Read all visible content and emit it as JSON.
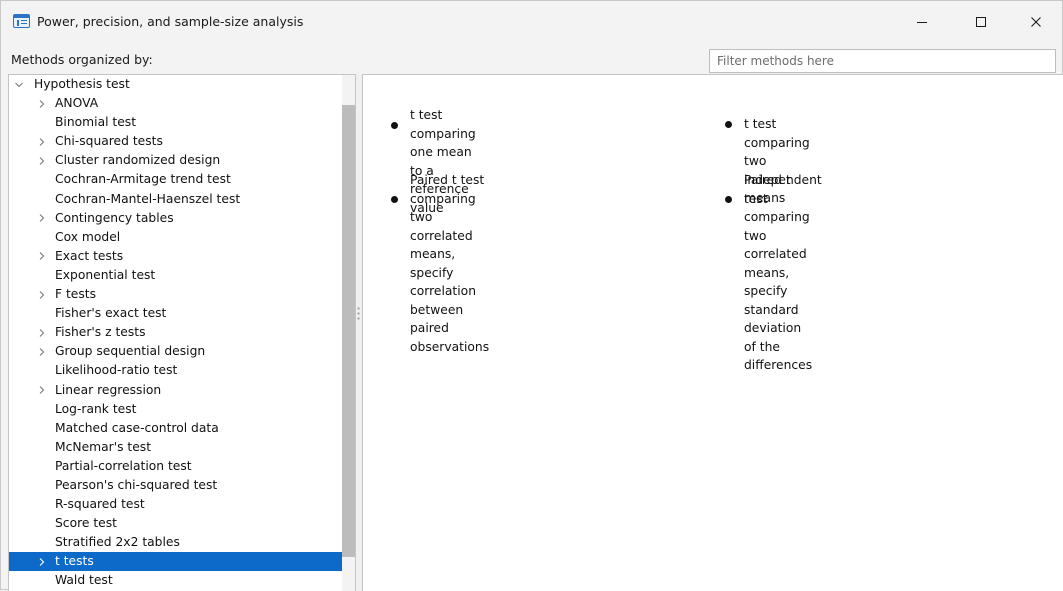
{
  "window": {
    "title": "Power, precision, and sample-size analysis",
    "minimize_icon": "minimize-icon",
    "maximize_icon": "maximize-icon",
    "close_icon": "close-icon"
  },
  "header": {
    "methods_label": "Methods organized by:",
    "filter_placeholder": "Filter methods here",
    "filter_value": ""
  },
  "tree": {
    "root": {
      "label": "Hypothesis test",
      "expanded": true
    },
    "items": [
      {
        "label": "ANOVA",
        "expandable": true,
        "selected": false
      },
      {
        "label": "Binomial test",
        "expandable": false,
        "selected": false
      },
      {
        "label": "Chi-squared tests",
        "expandable": true,
        "selected": false
      },
      {
        "label": "Cluster randomized design",
        "expandable": true,
        "selected": false
      },
      {
        "label": "Cochran-Armitage trend test",
        "expandable": false,
        "selected": false
      },
      {
        "label": "Cochran-Mantel-Haenszel test",
        "expandable": false,
        "selected": false
      },
      {
        "label": "Contingency tables",
        "expandable": true,
        "selected": false
      },
      {
        "label": "Cox model",
        "expandable": false,
        "selected": false
      },
      {
        "label": "Exact tests",
        "expandable": true,
        "selected": false
      },
      {
        "label": "Exponential test",
        "expandable": false,
        "selected": false
      },
      {
        "label": "F tests",
        "expandable": true,
        "selected": false
      },
      {
        "label": "Fisher's exact test",
        "expandable": false,
        "selected": false
      },
      {
        "label": "Fisher's z tests",
        "expandable": true,
        "selected": false
      },
      {
        "label": "Group sequential design",
        "expandable": true,
        "selected": false
      },
      {
        "label": "Likelihood-ratio test",
        "expandable": false,
        "selected": false
      },
      {
        "label": "Linear regression",
        "expandable": true,
        "selected": false
      },
      {
        "label": "Log-rank test",
        "expandable": false,
        "selected": false
      },
      {
        "label": "Matched case-control data",
        "expandable": false,
        "selected": false
      },
      {
        "label": "McNemar's test",
        "expandable": false,
        "selected": false
      },
      {
        "label": "Partial-correlation test",
        "expandable": false,
        "selected": false
      },
      {
        "label": "Pearson's chi-squared test",
        "expandable": false,
        "selected": false
      },
      {
        "label": "R-squared test",
        "expandable": false,
        "selected": false
      },
      {
        "label": "Score test",
        "expandable": false,
        "selected": false
      },
      {
        "label": "Stratified 2x2 tables",
        "expandable": false,
        "selected": false
      },
      {
        "label": "t tests",
        "expandable": true,
        "selected": true
      },
      {
        "label": "Wald test",
        "expandable": false,
        "selected": false
      }
    ]
  },
  "methods": [
    {
      "lines": [
        "t test comparing one mean to a reference",
        "value"
      ]
    },
    {
      "lines": [
        "t test comparing two independent means"
      ]
    },
    {
      "lines": [
        "Paired t test comparing two correlated",
        "means, specify correlation between paired",
        "observations"
      ]
    },
    {
      "lines": [
        "Paired t test comparing two correlated",
        "means, specify standard deviation of the",
        "differences"
      ]
    }
  ],
  "colors": {
    "selection": "#0e6ac9",
    "accent": "#2b73c4",
    "background": "#f3f3f3"
  }
}
